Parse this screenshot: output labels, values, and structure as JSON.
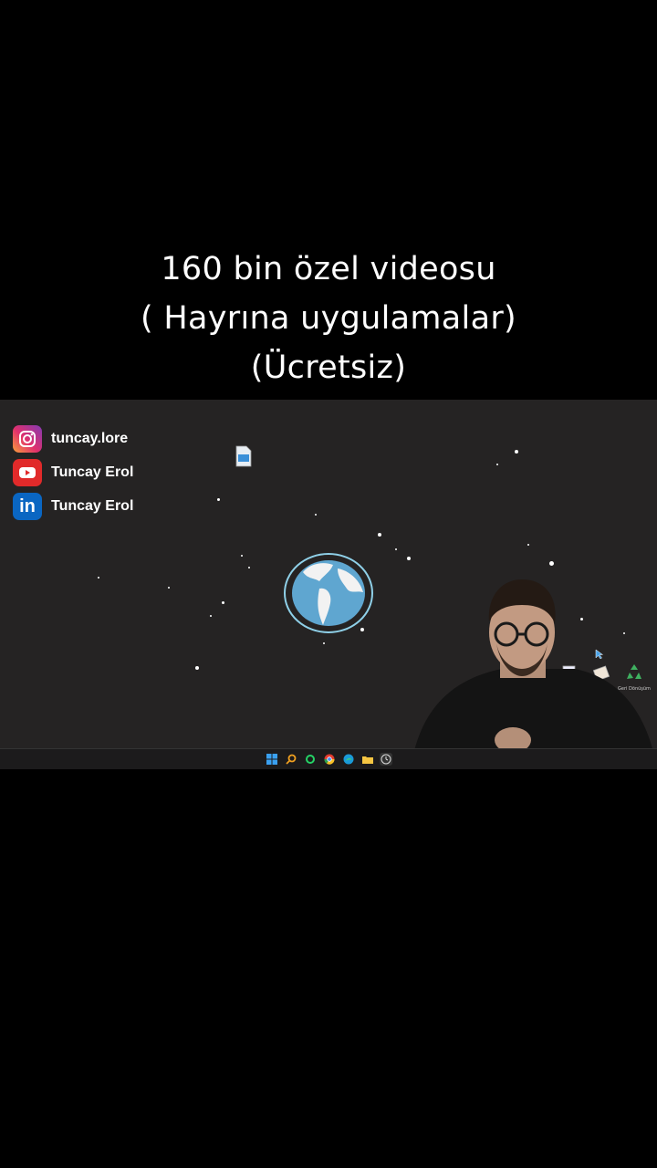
{
  "caption": {
    "line1": "160 bin özel videosu",
    "line2": "( Hayrına uygulamalar)",
    "line3": "(Ücretsiz)"
  },
  "social": {
    "instagram": "tuncay.lore",
    "youtube": "Tuncay Erol",
    "linkedin": "Tuncay Erol"
  },
  "desktop": {
    "icons": [
      "file-icon",
      "document-icon",
      "notepad-icon",
      "recycle-bin-icon"
    ],
    "recycle_label": "Geri Dönüşüm"
  },
  "taskbar": {
    "icons": [
      "windows-start-icon",
      "search-icon",
      "whatsapp-icon",
      "chrome-icon",
      "edge-icon",
      "file-explorer-icon",
      "clock-app-icon"
    ]
  },
  "colors": {
    "desktop_bg": "#252323",
    "globe_ocean": "#5fa6d0",
    "globe_ring": "#8fd0e8"
  }
}
